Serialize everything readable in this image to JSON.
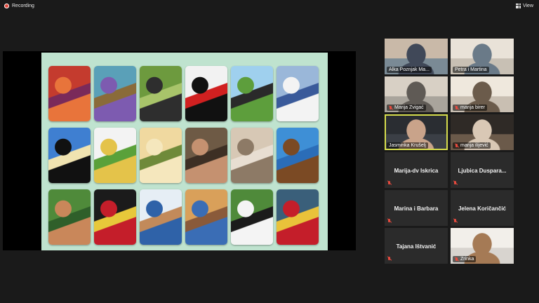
{
  "topbar": {
    "recording_label": "Recording",
    "view_label": "View"
  },
  "share": {
    "cards": [
      {
        "theme": "red-abstract",
        "colors": [
          "#c43b2e",
          "#e8743b",
          "#7a2a5a"
        ]
      },
      {
        "theme": "butterfly",
        "colors": [
          "#5aa0b8",
          "#7d5bb0",
          "#8a6b3a"
        ]
      },
      {
        "theme": "green-blocks",
        "colors": [
          "#6d9a3e",
          "#2e2e2e",
          "#a8c46a"
        ]
      },
      {
        "theme": "black-red-swirls",
        "colors": [
          "#f2f2f2",
          "#111111",
          "#d12020"
        ]
      },
      {
        "theme": "bird-over-hill",
        "colors": [
          "#9fd0ee",
          "#5d9e3c",
          "#2a2a2a"
        ]
      },
      {
        "theme": "figure-with-sheet",
        "colors": [
          "#9ab7d9",
          "#f3f3f3",
          "#3a5a9a"
        ]
      },
      {
        "theme": "spiral",
        "colors": [
          "#3f7fd1",
          "#111111",
          "#f0e3b0"
        ]
      },
      {
        "theme": "lizard-wall",
        "colors": [
          "#f3f3f3",
          "#e4c34a",
          "#5aa13a"
        ]
      },
      {
        "theme": "desert-plant",
        "colors": [
          "#f0d9a0",
          "#f5e7bd",
          "#6f8a3a"
        ]
      },
      {
        "theme": "doorway",
        "colors": [
          "#6e5a45",
          "#c59170",
          "#3d2f24"
        ]
      },
      {
        "theme": "wolves",
        "colors": [
          "#d7c8b5",
          "#8d7a66",
          "#e8ded2"
        ]
      },
      {
        "theme": "eagle",
        "colors": [
          "#3e8fd6",
          "#7b4a24",
          "#2b6db8"
        ]
      },
      {
        "theme": "forest-figures",
        "colors": [
          "#4f8a3a",
          "#c9875a",
          "#2f5f2a"
        ]
      },
      {
        "theme": "red-knot",
        "colors": [
          "#1b1b1b",
          "#c41e2a",
          "#e7c83a"
        ]
      },
      {
        "theme": "man-binoculars",
        "colors": [
          "#e6eef5",
          "#2f62a8",
          "#c28a5a"
        ]
      },
      {
        "theme": "kneeling-figure",
        "colors": [
          "#d9a05a",
          "#3a6db5",
          "#8a5a3a"
        ]
      },
      {
        "theme": "cow",
        "colors": [
          "#4f8a3a",
          "#f4f4f4",
          "#1b1b1b"
        ]
      },
      {
        "theme": "mosaic",
        "colors": [
          "#3a5f7a",
          "#c41e2a",
          "#e9c23a"
        ]
      }
    ]
  },
  "gallery": {
    "participants": [
      {
        "name": "Alka Poznjak Ma...",
        "video": true,
        "muted": false,
        "speaking": false,
        "colors": [
          "#7a8a95",
          "#c9b9a8",
          "#404858"
        ]
      },
      {
        "name": "Petra i Martina",
        "video": true,
        "muted": false,
        "speaking": false,
        "colors": [
          "#c8c0b4",
          "#e9e2d8",
          "#6a7a88"
        ]
      },
      {
        "name": "Marija Zvigać",
        "video": true,
        "muted": true,
        "speaking": false,
        "colors": [
          "#a9a49c",
          "#d8d0c5",
          "#5f5a55"
        ]
      },
      {
        "name": "marija birer",
        "video": true,
        "muted": true,
        "speaking": false,
        "colors": [
          "#c9bfb2",
          "#efe8dd",
          "#6b5b4b"
        ]
      },
      {
        "name": "Jasminka Krušelj",
        "video": true,
        "muted": false,
        "speaking": true,
        "colors": [
          "#3b3f46",
          "#2a2d32",
          "#c9a38a"
        ]
      },
      {
        "name": "marija ilijević",
        "video": true,
        "muted": true,
        "speaking": false,
        "colors": [
          "#6b5a4a",
          "#2f2a26",
          "#d9c8b5"
        ]
      },
      {
        "name": "Marija-dv Iskrica",
        "video": false,
        "muted": true,
        "speaking": false
      },
      {
        "name": "Ljubica  Duspara...",
        "video": false,
        "muted": true,
        "speaking": false
      },
      {
        "name": "Marina i Barbara",
        "video": false,
        "muted": true,
        "speaking": false
      },
      {
        "name": "Jelena Koričančić",
        "video": false,
        "muted": true,
        "speaking": false
      },
      {
        "name": "Tajana Ištvanić",
        "video": false,
        "muted": true,
        "speaking": false
      },
      {
        "name": "Zrinka",
        "video": true,
        "muted": true,
        "speaking": false,
        "colors": [
          "#d8d4cf",
          "#f2efea",
          "#a57a55"
        ]
      }
    ]
  }
}
